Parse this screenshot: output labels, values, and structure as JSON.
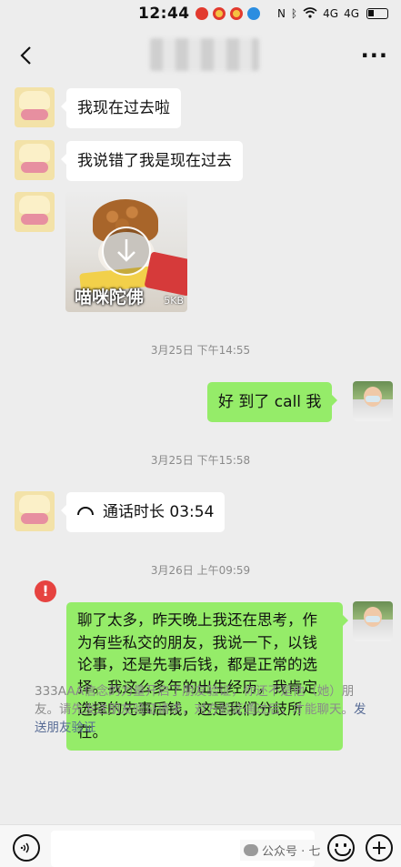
{
  "status_bar": {
    "time": "12:44",
    "signal_1": "4G",
    "signal_2": "4G"
  },
  "header": {
    "contact_name": "",
    "more_label": "···"
  },
  "messages": [
    {
      "side": "left",
      "type": "text",
      "text": "我现在过去啦"
    },
    {
      "side": "left",
      "type": "text",
      "text": "我说错了我是现在过去"
    },
    {
      "side": "left",
      "type": "video",
      "caption": "喵咪陀佛",
      "size": "5KB"
    },
    {
      "type": "timestamp",
      "text": "3月25日 下午14:55"
    },
    {
      "side": "right",
      "type": "text",
      "text": "好 到了 call 我"
    },
    {
      "type": "timestamp",
      "text": "3月25日 下午15:58"
    },
    {
      "side": "left",
      "type": "call",
      "text": "通话时长 03:54"
    },
    {
      "type": "timestamp",
      "text": "3月26日 上午09:59"
    },
    {
      "side": "right",
      "type": "text",
      "status": "failed",
      "text": "聊了太多，昨天晚上我还在思考，作为有些私交的朋友，我说一下，以钱论事，还是先事后钱，都是正常的选择。我这么多年的出生经历，我肯定选择的先事后钱，这是我们分歧所在。"
    }
  ],
  "error_mark": "!",
  "system_notice": {
    "text": "333AAA信念的力量开启了朋友验证，你还不是他（她）朋友。请先发送朋友验证请求，对方验证通过后，才能聊天。",
    "link": "发送朋友验证"
  },
  "input_bar": {
    "input_value": "",
    "watermark": "公众号 · 七"
  },
  "colors": {
    "background": "#ededed",
    "bubble_self": "#95ec69",
    "bubble_other": "#ffffff",
    "link": "#576b95",
    "error": "#e64340"
  }
}
